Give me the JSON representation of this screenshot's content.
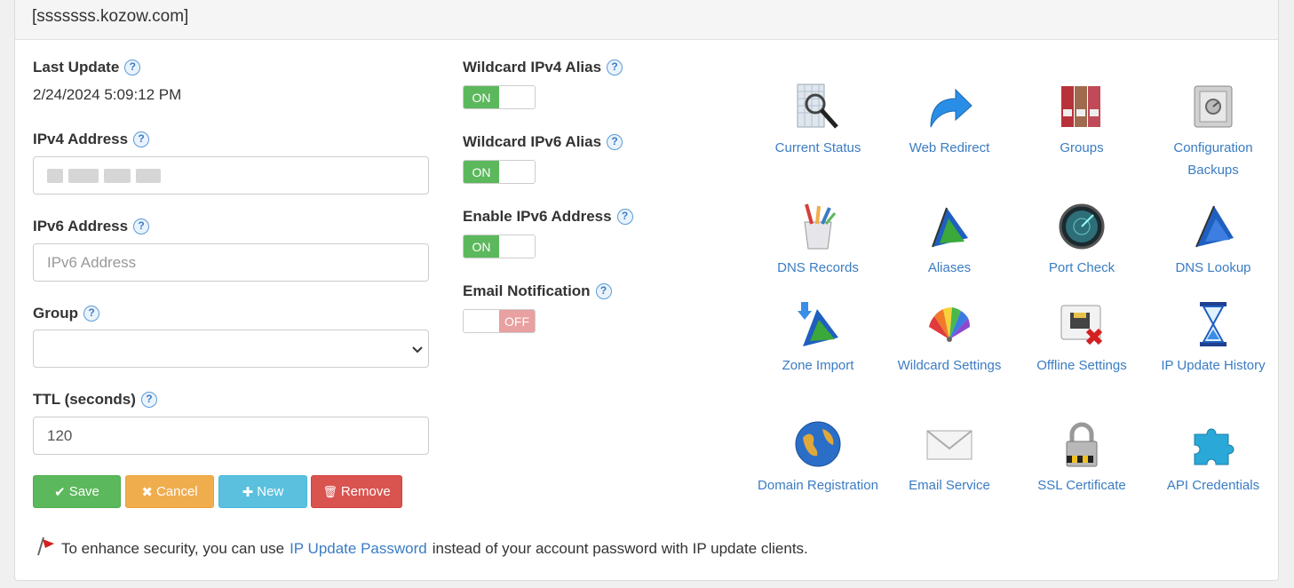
{
  "header": {
    "title": "[sssssss.kozow.com]"
  },
  "help_glyph": "?",
  "left": {
    "last_update": {
      "label": "Last Update",
      "value": "2/24/2024 5:09:12 PM"
    },
    "ipv4": {
      "label": "IPv4 Address"
    },
    "ipv6": {
      "label": "IPv6 Address",
      "placeholder": "IPv6 Address"
    },
    "group": {
      "label": "Group"
    },
    "ttl": {
      "label": "TTL (seconds)",
      "value": "120"
    }
  },
  "buttons": {
    "save": {
      "icon": "✔",
      "label": "Save"
    },
    "cancel": {
      "icon": "✖",
      "label": "Cancel"
    },
    "new": {
      "icon": "✚",
      "label": "New"
    },
    "remove": {
      "icon": "🗑",
      "label": "Remove"
    }
  },
  "toggles": {
    "on_text": "ON",
    "off_text": "OFF",
    "wildcard_ipv4": {
      "label": "Wildcard IPv4 Alias",
      "state": "on"
    },
    "wildcard_ipv6": {
      "label": "Wildcard IPv6 Alias",
      "state": "on"
    },
    "enable_ipv6": {
      "label": "Enable IPv6 Address",
      "state": "on"
    },
    "email_notification": {
      "label": "Email Notification",
      "state": "off"
    }
  },
  "tiles": [
    {
      "icon": "current-status-icon",
      "label": "Current Status"
    },
    {
      "icon": "web-redirect-icon",
      "label": "Web Redirect"
    },
    {
      "icon": "groups-icon",
      "label": "Groups"
    },
    {
      "icon": "configuration-backups-icon",
      "label": "Configuration Backups"
    },
    {
      "icon": "dns-records-icon",
      "label": "DNS Records"
    },
    {
      "icon": "aliases-icon",
      "label": "Aliases"
    },
    {
      "icon": "port-check-icon",
      "label": "Port Check"
    },
    {
      "icon": "dns-lookup-icon",
      "label": "DNS Lookup"
    },
    {
      "icon": "zone-import-icon",
      "label": "Zone Import"
    },
    {
      "icon": "wildcard-settings-icon",
      "label": "Wildcard Settings"
    },
    {
      "icon": "offline-settings-icon",
      "label": "Offline Settings"
    },
    {
      "icon": "ip-update-history-icon",
      "label": "IP Update History"
    },
    {
      "icon": "domain-registration-icon",
      "label": "Domain Registration"
    },
    {
      "icon": "email-service-icon",
      "label": "Email Service"
    },
    {
      "icon": "ssl-certificate-icon",
      "label": "SSL Certificate"
    },
    {
      "icon": "api-credentials-icon",
      "label": "API Credentials"
    }
  ],
  "notice": {
    "icon": "red-flag-icon",
    "prefix": "To enhance security, you can use",
    "link": "IP Update Password",
    "suffix": "instead of your account password with IP update clients."
  },
  "colors": {
    "save": "#5cb85c",
    "cancel": "#f0ad4e",
    "new": "#5bc0de",
    "remove": "#d9534f",
    "link": "#3a7cc3"
  }
}
